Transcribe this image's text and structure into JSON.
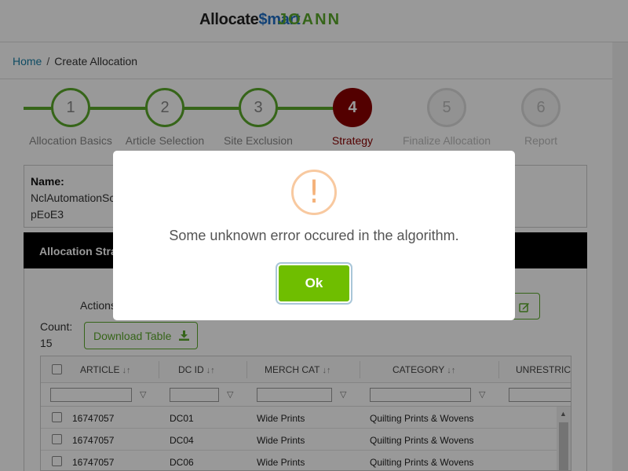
{
  "header": {
    "logo_allocate": "Allocate",
    "logo_smart": "$mart",
    "logo_brand": "JOANN"
  },
  "breadcrumb": {
    "home": "Home",
    "separator": "/",
    "current": "Create Allocation"
  },
  "stepper": {
    "steps": [
      {
        "number": "1",
        "label": "Allocation Basics",
        "state": "done"
      },
      {
        "number": "2",
        "label": "Article Selection",
        "state": "done"
      },
      {
        "number": "3",
        "label": "Site Exclusion",
        "state": "done"
      },
      {
        "number": "4",
        "label": "Strategy",
        "state": "active"
      },
      {
        "number": "5",
        "label": "Finalize Allocation",
        "state": "future"
      },
      {
        "number": "6",
        "label": "Report",
        "state": "future"
      }
    ]
  },
  "name_box": {
    "label": "Name:",
    "value_line1": "NclAutomationSc",
    "value_line2": "pEoE3"
  },
  "strategy": {
    "title": "Allocation Stra",
    "actions_label": "Actions",
    "count_label": "Count:",
    "count_value": "15",
    "download_label": "Download Table",
    "edit_icon": "edit-icon"
  },
  "table": {
    "columns": [
      "ARTICLE",
      "DC ID",
      "MERCH CAT",
      "CATEGORY",
      "UNRESTRICT"
    ],
    "sort_glyph": "↓↑",
    "filter_glyph": "▽",
    "rows": [
      {
        "article": "16747057",
        "dc_id": "DC01",
        "merch_cat": "Wide Prints",
        "category": "Quilting Prints & Wovens"
      },
      {
        "article": "16747057",
        "dc_id": "DC04",
        "merch_cat": "Wide Prints",
        "category": "Quilting Prints & Wovens"
      },
      {
        "article": "16747057",
        "dc_id": "DC06",
        "merch_cat": "Wide Prints",
        "category": "Quilting Prints & Wovens"
      }
    ]
  },
  "modal": {
    "icon_glyph": "!",
    "message": "Some unknown error occured in the algorithm.",
    "ok_label": "Ok"
  },
  "colors": {
    "accent_green": "#5aa92b",
    "active_step": "#8b0000",
    "ok_button": "#6fbe00",
    "warning": "#f8c9a0"
  }
}
